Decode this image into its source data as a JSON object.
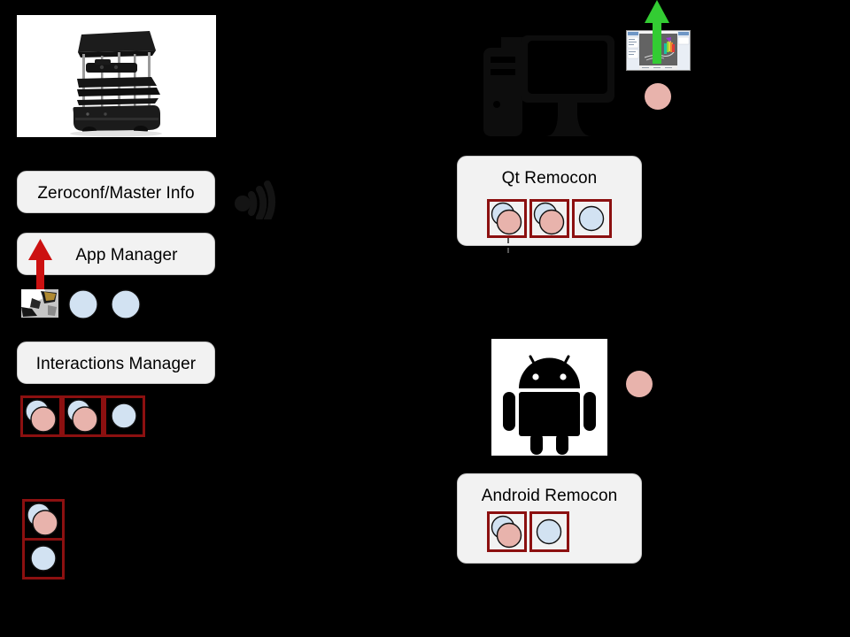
{
  "diagram": {
    "background_color": "#000000",
    "box_fill": "#f2f2f2",
    "icon_border_color": "#8c1010",
    "circle_pink": "#e8b3ac",
    "circle_blue": "#d2e2f2",
    "arrow_red": "#cc1111",
    "arrow_green": "#33cc33",
    "wifi_color": "#141414",
    "computer_color": "#0d0d0d"
  },
  "robot_side": {
    "photo_alt": "turtlebot-robot-photo",
    "boxes": [
      {
        "label": "Zeroconf/Master Info"
      },
      {
        "label": "App Manager"
      },
      {
        "label": "Interactions Manager"
      }
    ],
    "app_manager_row": {
      "map_thumbnail_alt": "map-thumbnail",
      "plain_circles": [
        "blue",
        "blue"
      ]
    },
    "interactions_row": [
      {
        "kind": "pair",
        "back": "blue",
        "front": "pink"
      },
      {
        "kind": "pair",
        "back": "blue",
        "front": "pink"
      },
      {
        "kind": "single",
        "front": "blue"
      }
    ],
    "pending_stack": [
      {
        "kind": "pair",
        "back": "blue",
        "front": "pink"
      },
      {
        "kind": "single",
        "front": "blue"
      }
    ],
    "wifi_alt": "wifi-signal-icon",
    "red_arrow_alt": "red-up-arrow"
  },
  "pc_side": {
    "computer_alt": "desktop-computer-icon",
    "rviz_thumbnail_alt": "rviz-visualization-thumbnail",
    "green_arrow_alt": "green-up-arrow",
    "free_circle": "pink",
    "box": {
      "label": "Qt Remocon",
      "icons": [
        {
          "kind": "pair",
          "back": "blue",
          "front": "pink"
        },
        {
          "kind": "pair",
          "back": "blue",
          "front": "pink"
        },
        {
          "kind": "single",
          "front": "blue"
        }
      ]
    }
  },
  "android_side": {
    "android_alt": "android-robot-logo",
    "free_circle": "pink",
    "box": {
      "label": "Android Remocon",
      "icons": [
        {
          "kind": "pair",
          "back": "blue",
          "front": "pink"
        },
        {
          "kind": "single",
          "front": "blue"
        }
      ]
    }
  }
}
